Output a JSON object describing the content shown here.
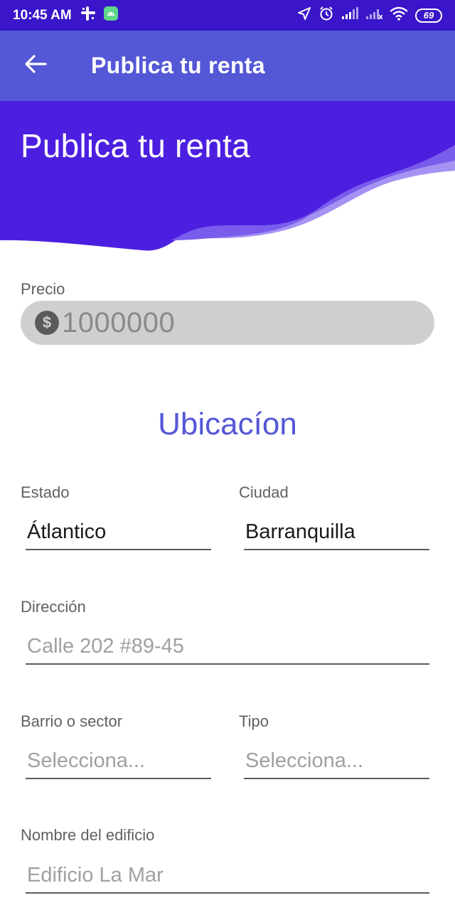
{
  "status_bar": {
    "time": "10:45 AM",
    "battery": "69"
  },
  "app_bar": {
    "title": "Publica tu renta"
  },
  "hero": {
    "title": "Publica tu renta",
    "colors": {
      "dark": "#4c1fe0",
      "mid": "#7a5cec",
      "light": "#a592f3"
    }
  },
  "form": {
    "price": {
      "label": "Precio",
      "value": "1000000",
      "currency_icon": "$"
    },
    "section_title": "Ubicacíon",
    "estado": {
      "label": "Estado",
      "value": "Átlantico"
    },
    "ciudad": {
      "label": "Ciudad",
      "value": "Barranquilla"
    },
    "direccion": {
      "label": "Dirección",
      "placeholder": "Calle 202 #89-45"
    },
    "barrio": {
      "label": "Barrio o sector",
      "placeholder": "Selecciona..."
    },
    "tipo": {
      "label": "Tipo",
      "placeholder": "Selecciona..."
    },
    "edificio": {
      "label": "Nombre del edificio",
      "placeholder": "Edificio La Mar"
    }
  }
}
